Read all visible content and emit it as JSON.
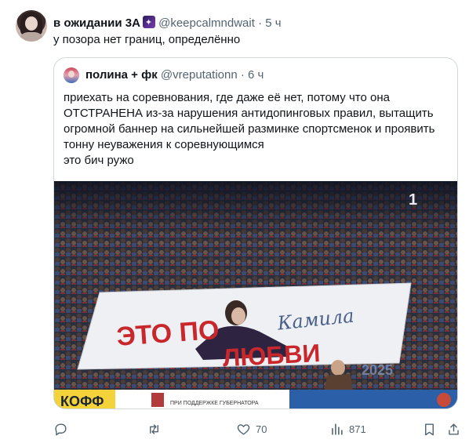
{
  "tweet": {
    "author_name": "в ожидании 3А",
    "author_handle": "@keepcalmndwait",
    "separator": "·",
    "time": "5 ч",
    "text": "у позора нет границ, определённо",
    "avatar_icon": "user-avatar"
  },
  "quote": {
    "author_name": "полина + фк",
    "author_handle": "@vreputationn",
    "separator": "·",
    "time": "6 ч",
    "text_lines": [
      "приехать на соревнования, где даже её нет, потому что она",
      "ОТСТРАНЕНА из-за нарушения антидопинговых правил, вытащить",
      "огромной баннер на сильнейшей разминке спортсменок и проявить",
      "тонну неуважения к соревнующимся",
      "это бич ружо"
    ],
    "media": {
      "banner_text_top": "ЭТО ПО",
      "banner_text_bottom": "ЛЮБВИ",
      "banner_script": "Камила",
      "board_text": "ПРИ ПОДДЕРЖКЕ ГУБЕРНАТОРА",
      "board_logo": "КОФФ",
      "channel_logo": "1",
      "year_text": "2025"
    }
  },
  "actions": {
    "reply_icon": "reply-icon",
    "retweet_icon": "retweet-icon",
    "like_icon": "heart-icon",
    "like_count": "70",
    "views_icon": "views-icon",
    "views_count": "871",
    "bookmark_icon": "bookmark-icon",
    "share_icon": "share-icon"
  },
  "colors": {
    "text_primary": "#0f1419",
    "text_secondary": "#536471",
    "border": "#cfd9de",
    "banner_red": "#c8282c"
  }
}
